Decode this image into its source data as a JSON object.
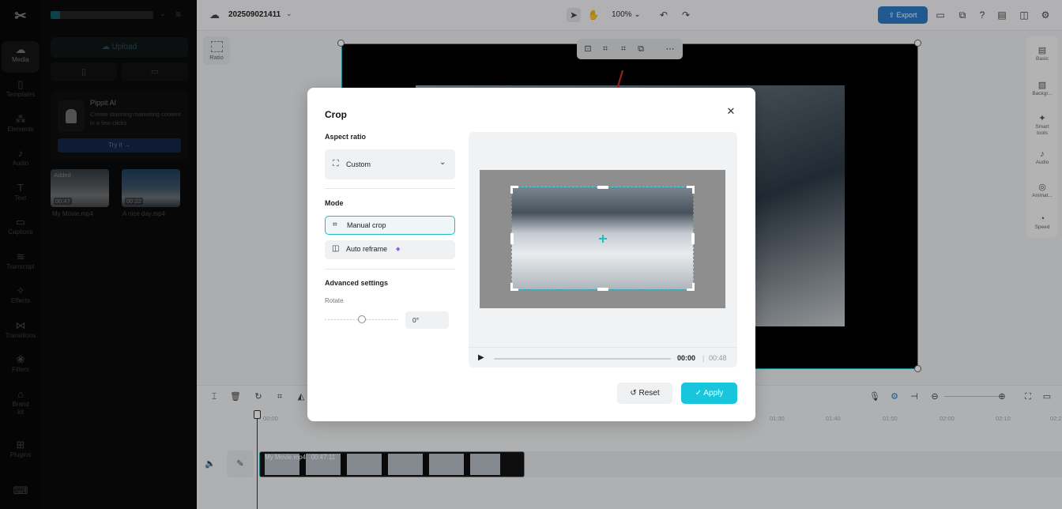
{
  "sidebar": {
    "items": [
      {
        "label": "Media",
        "icon": "media-icon"
      },
      {
        "label": "Templates",
        "icon": "templates-icon"
      },
      {
        "label": "Elements",
        "icon": "elements-icon"
      },
      {
        "label": "Audio",
        "icon": "audio-icon"
      },
      {
        "label": "Text",
        "icon": "text-icon"
      },
      {
        "label": "Captions",
        "icon": "captions-icon"
      },
      {
        "label": "Transcript",
        "icon": "transcript-icon"
      },
      {
        "label": "Effects",
        "icon": "effects-icon"
      },
      {
        "label": "Transitions",
        "icon": "transitions-icon"
      },
      {
        "label": "Filters",
        "icon": "filters-icon"
      },
      {
        "label": "Brand kit",
        "icon": "brand-kit-icon"
      },
      {
        "label": "Plugins",
        "icon": "plugins-icon"
      }
    ]
  },
  "media_panel": {
    "upload_label": "Upload",
    "promo": {
      "title": "Pippit AI",
      "description": "Create stunning marketing content in a few clicks",
      "button_label": "Try it →"
    },
    "clips": [
      {
        "badge": "Added",
        "duration": "00:47",
        "name": "My Movie.mp4"
      },
      {
        "badge": "",
        "duration": "00:22",
        "name": "A nice day.mp4"
      }
    ]
  },
  "topbar": {
    "project_name": "202509021411",
    "zoom": "100%",
    "export_label": "Export"
  },
  "canvas": {
    "ratio_label": "Ratio"
  },
  "right_panel": {
    "items": [
      {
        "label": "Basic",
        "icon": "basic-icon"
      },
      {
        "label": "Backgr...",
        "icon": "background-icon"
      },
      {
        "label": "Smart tools",
        "icon": "smart-tools-icon"
      },
      {
        "label": "Audio",
        "icon": "audio-icon"
      },
      {
        "label": "Animat...",
        "icon": "animation-icon"
      },
      {
        "label": "Speed",
        "icon": "speed-icon"
      }
    ]
  },
  "timeline": {
    "ticks": [
      "00:00",
      "01:30",
      "01:40",
      "01:50",
      "02:00",
      "02:10",
      "02:20"
    ],
    "clip_label": "My Movie.mp4",
    "clip_duration": "00:47:11"
  },
  "crop_dialog": {
    "title": "Crop",
    "aspect_ratio_label": "Aspect ratio",
    "aspect_ratio_value": "Custom",
    "mode_label": "Mode",
    "mode_options": [
      "Manual crop",
      "Auto reframe"
    ],
    "selected_mode": "Manual crop",
    "advanced_label": "Advanced settings",
    "rotate_label": "Rotate",
    "rotate_value": "0°",
    "current_time": "00:00",
    "time_separator": "|",
    "total_time": "00:48",
    "reset_label": "Reset",
    "apply_label": "Apply"
  },
  "colors": {
    "accent": "#17c5dc",
    "export": "#2d7cc6",
    "selection_border": "#1fbcc8",
    "annotation_arrow": "#e5312b"
  }
}
